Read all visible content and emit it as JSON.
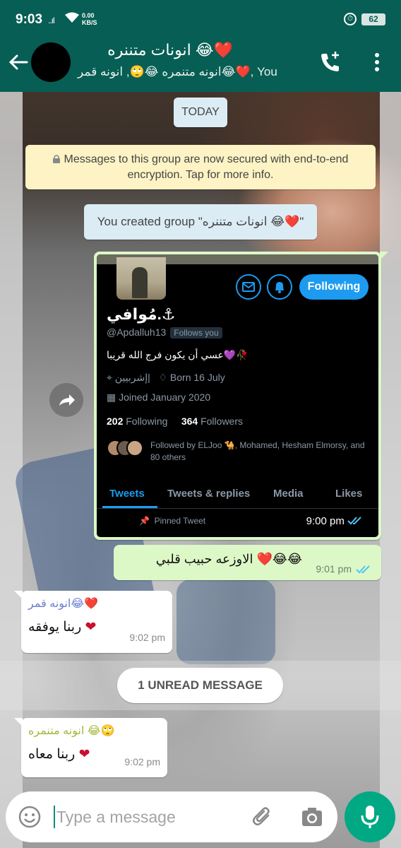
{
  "status_bar": {
    "time": "9:03",
    "signal": "..ıl",
    "net_speed_value": "0.00",
    "net_speed_unit": "KB/S",
    "battery": "62"
  },
  "header": {
    "group_name": "انونات متننره 😂❤️",
    "members": "انونه متنمره 😂🙄, انونه قمر😂❤️, You"
  },
  "chat": {
    "date_chip": "TODAY",
    "encryption_notice": "Messages to this group are now secured with end-to-end encryption. Tap for more info.",
    "created_group": "You created group \"انونات متننره 😂❤️\"",
    "image_message": {
      "time": "9:00 pm",
      "twitter": {
        "follow_button": "Following",
        "display_name": "مُوافي.⚓",
        "handle": "@Apdalluh13",
        "follows_you": "Follows you",
        "bio": "عسي أن يكون فرج الله قريبا💜🥀",
        "location": "إشربيين|",
        "born": "Born 16 July",
        "joined": "Joined January 2020",
        "following_count": "202",
        "following_label": "Following",
        "followers_count": "364",
        "followers_label": "Followers",
        "followed_by": "Followed by ELJoo 🐪, Mohamed, Hesham Elmorsy, and 80 others",
        "tabs": [
          "Tweets",
          "Tweets & replies",
          "Media",
          "Likes"
        ],
        "pinned": "Pinned Tweet"
      }
    },
    "outgoing_message": {
      "text": "الاوزعه حبيب قلبي ❤️😂😂",
      "time": "9:01 pm"
    },
    "incoming_1": {
      "sender": "انونه قمر😂❤️",
      "sender_color": "#6a7fd1",
      "text": "ربنا يوفقه",
      "time": "9:02 pm"
    },
    "unread_label": "1 UNREAD MESSAGE",
    "incoming_2": {
      "sender": "انونه متنمره 😂🙄",
      "sender_color": "#a2b83a",
      "text": "ربنا معاه",
      "time": "9:02 pm"
    }
  },
  "composer": {
    "placeholder": "Type a message"
  },
  "colors": {
    "header": "#075e54",
    "outgoing_bubble": "#dcf8c6",
    "mic_button": "#00a884",
    "twitter_blue": "#1d9bf0"
  }
}
